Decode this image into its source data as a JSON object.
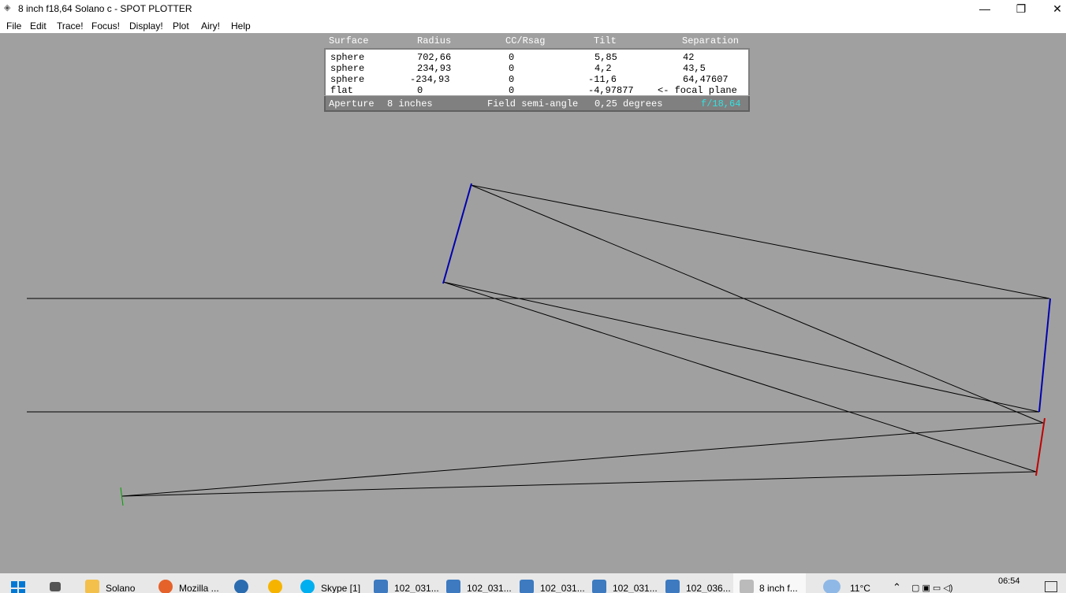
{
  "window": {
    "title": "8 inch f18,64 Solano c - SPOT PLOTTER",
    "controls": {
      "minimize": "—",
      "maximize": "❐",
      "close": "✕"
    }
  },
  "menu": [
    "File",
    "Edit",
    "Trace!",
    "Focus!",
    "Display!",
    "Plot",
    "Airy!",
    "Help"
  ],
  "table": {
    "headers": [
      "Surface",
      "Radius",
      "CC/Rsag",
      "Tilt",
      "Separation"
    ],
    "rows": [
      [
        "sphere",
        "702,66",
        "0",
        "5,85",
        "42"
      ],
      [
        "sphere",
        "234,93",
        "0",
        "4,2",
        "43,5"
      ],
      [
        "sphere",
        "-234,93",
        "0",
        "-11,6",
        "64,47607"
      ],
      [
        "flat",
        "0",
        "0",
        "-4,97877",
        "<- focal plane"
      ]
    ],
    "footer": {
      "aperture_label": "Aperture",
      "aperture_value": "8 inches",
      "field_label": "Field semi-angle",
      "field_value": "0,25 degrees",
      "fnumber": "f/18,64"
    }
  },
  "colors": {
    "background": "#a0a0a0",
    "mirror": "#0000b0",
    "tertiary": "#c00000",
    "focal": "#00a000",
    "ray": "#000000",
    "fnumber": "#33e0e0"
  },
  "taskbar": {
    "items": [
      {
        "label": "Solano",
        "icon": "folder-icon"
      },
      {
        "label": "Mozilla ...",
        "icon": "firefox-icon"
      },
      {
        "label": "",
        "icon": "app-icon"
      },
      {
        "label": "",
        "icon": "chrome-icon"
      },
      {
        "label": "Skype [1]",
        "icon": "skype-icon"
      },
      {
        "label": "102_031...",
        "icon": "photos-icon"
      },
      {
        "label": "102_031...",
        "icon": "photos-icon"
      },
      {
        "label": "102_031...",
        "icon": "photos-icon"
      },
      {
        "label": "102_031...",
        "icon": "photos-icon"
      },
      {
        "label": "102_036...",
        "icon": "photos-icon"
      },
      {
        "label": "8 inch f...",
        "icon": "spot-plotter-icon"
      }
    ],
    "weather": "11°C",
    "time": "06:54"
  }
}
